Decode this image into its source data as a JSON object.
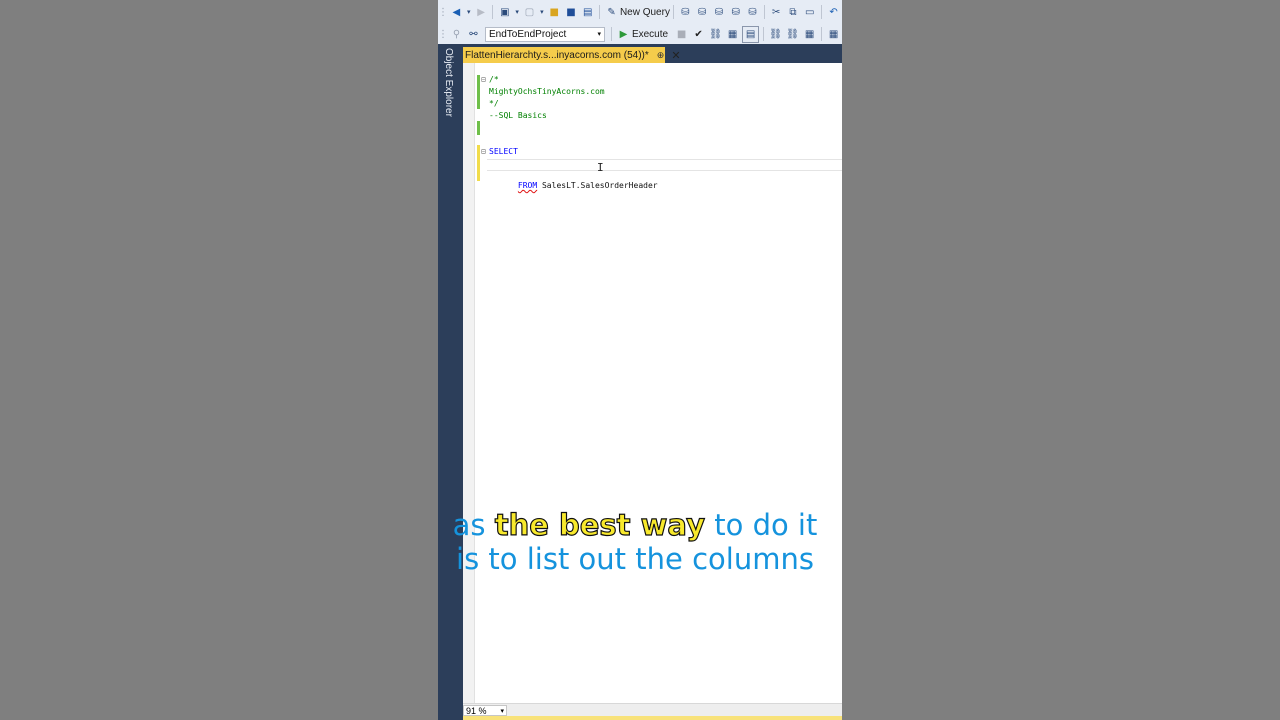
{
  "toolbar": {
    "new_query_label": "New Query",
    "database": "EndToEndProject",
    "execute_label": "Execute"
  },
  "sidebar": {
    "object_explorer_label": "Object Explorer"
  },
  "tab": {
    "title": "FlattenHierarchty.s...inyacorns.com (54))*",
    "pin": "⊕",
    "close": "✕"
  },
  "code": {
    "line1": "/*",
    "line2": "MightyOchsTinyAcorns.com",
    "line3": "*/",
    "line4": "--SQL Basics",
    "select_kw": "SELECT",
    "from_kw": "FROM",
    "from_obj": " SalesLT.SalesOrderHeader"
  },
  "status": {
    "zoom": "91 %"
  },
  "caption": {
    "part1": "as ",
    "highlight": "the best way",
    "part2": " to do it is to list out the columns"
  },
  "colors": {
    "tab_active": "#f5cc4b",
    "sidebar": "#2c3e5a",
    "caption_text": "#1593dd",
    "caption_highlight": "#f8e92c",
    "change_saved": "#6fbf4a",
    "change_unsaved": "#f1dc4b"
  }
}
